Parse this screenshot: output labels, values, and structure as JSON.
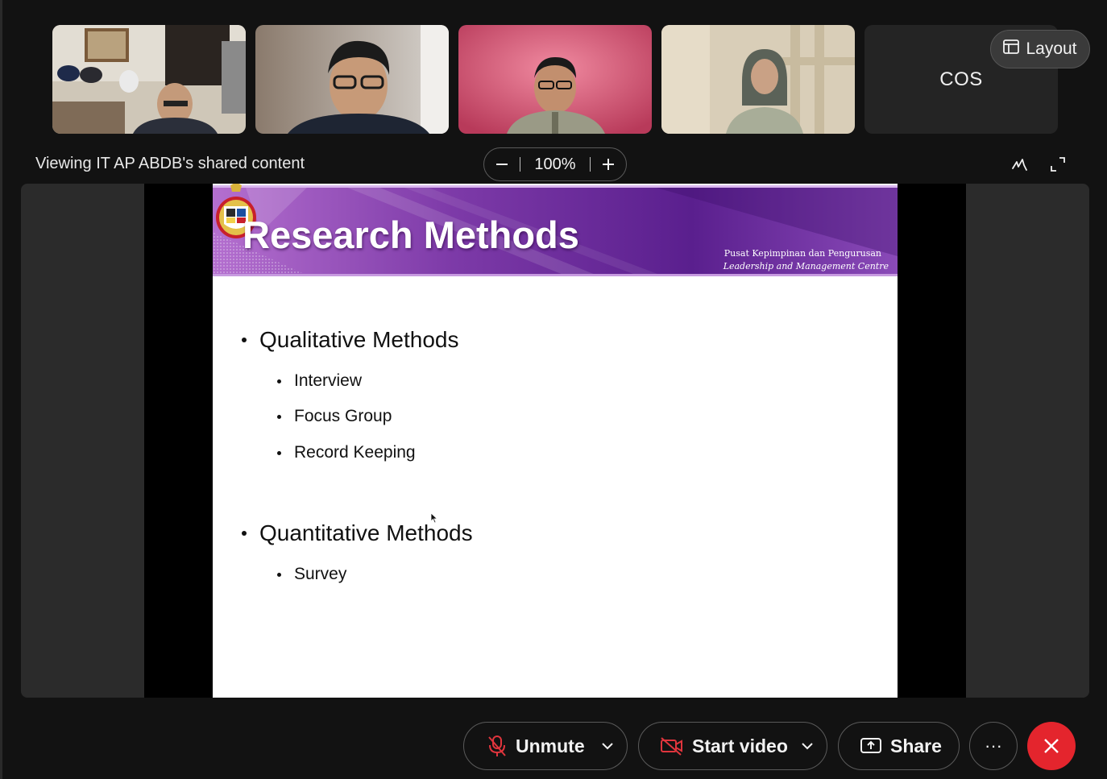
{
  "participants": [
    {
      "id": "p1",
      "name": ""
    },
    {
      "id": "p2",
      "name": ""
    },
    {
      "id": "p3",
      "name": ""
    },
    {
      "id": "p4",
      "name": ""
    },
    {
      "id": "p5",
      "name": "COS"
    }
  ],
  "layout_button": {
    "label": "Layout",
    "icon": "layout-icon"
  },
  "share_bar": {
    "viewing_text": "Viewing IT AP ABDB's shared content",
    "zoom_level": "100%",
    "zoom_out_icon": "minus-icon",
    "zoom_in_icon": "plus-icon",
    "annotate_icon": "annotate-icon",
    "fullscreen_icon": "fullscreen-icon"
  },
  "slide": {
    "title": "Research Methods",
    "org_line1": "Pusat Kepimpinan dan Pengurusan",
    "org_line2": "Leadership and Management Centre",
    "sections": [
      {
        "heading": "Qualitative Methods",
        "items": [
          "Interview",
          "Focus Group",
          "Record Keeping"
        ]
      },
      {
        "heading": "Quantitative Methods",
        "items": [
          "Survey"
        ]
      }
    ]
  },
  "toolbar": {
    "unmute_label": "Unmute",
    "start_video_label": "Start video",
    "share_label": "Share",
    "more_label": "···",
    "colors": {
      "end_call": "#e4252d",
      "muted_icon": "#e0353d"
    }
  }
}
